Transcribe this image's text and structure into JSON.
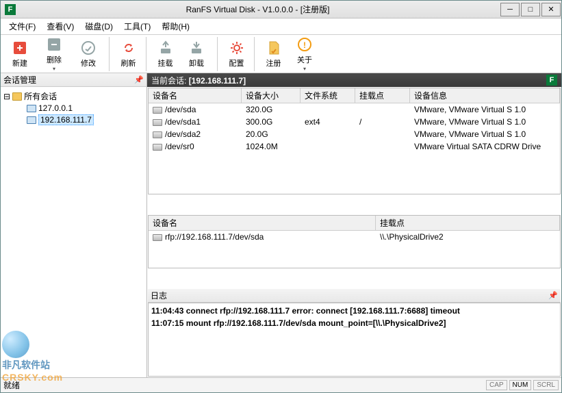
{
  "window": {
    "title": "RanFS Virtual Disk - V1.0.0.0 - [注册版]",
    "icon_letter": "F"
  },
  "menu": {
    "file": "文件(F)",
    "view": "查看(V)",
    "disk": "磁盘(D)",
    "tool": "工具(T)",
    "help": "帮助(H)"
  },
  "toolbar": {
    "new": "新建",
    "delete": "删除",
    "modify": "修改",
    "refresh": "刷新",
    "mount": "挂载",
    "unmount": "卸载",
    "config": "配置",
    "register": "注册",
    "about": "关于"
  },
  "sidebar": {
    "title": "会话管理",
    "root": "所有会话",
    "nodes": [
      "127.0.0.1",
      "192.168.111.7"
    ],
    "selected": "192.168.111.7"
  },
  "session_bar": {
    "label": "当前会话:",
    "value": "[192.168.111.7]"
  },
  "devices": {
    "headers": {
      "name": "设备名",
      "size": "设备大小",
      "fs": "文件系统",
      "mount": "挂载点",
      "info": "设备信息"
    },
    "rows": [
      {
        "name": "/dev/sda",
        "size": "320.0G",
        "fs": "",
        "mount": "",
        "info": "VMware, VMware Virtual S 1.0"
      },
      {
        "name": "/dev/sda1",
        "size": "300.0G",
        "fs": "ext4",
        "mount": "/",
        "info": "VMware, VMware Virtual S 1.0"
      },
      {
        "name": "/dev/sda2",
        "size": "20.0G",
        "fs": "",
        "mount": "",
        "info": "VMware, VMware Virtual S 1.0"
      },
      {
        "name": "/dev/sr0",
        "size": "1024.0M",
        "fs": "",
        "mount": "",
        "info": "VMware Virtual SATA CDRW Drive"
      }
    ]
  },
  "mounts": {
    "headers": {
      "name": "设备名",
      "mount": "挂载点"
    },
    "rows": [
      {
        "name": "rfp://192.168.111.7/dev/sda",
        "mount": "\\\\.\\PhysicalDrive2"
      }
    ]
  },
  "log": {
    "title": "日志",
    "lines": [
      "11:04:43 connect rfp://192.168.111.7 error: connect [192.168.111.7:6688] timeout",
      "11:07:15 mount rfp://192.168.111.7/dev/sda mount_point=[\\\\.\\PhysicalDrive2]"
    ]
  },
  "status": {
    "ready": "就绪",
    "cap": "CAP",
    "num": "NUM",
    "scrl": "SCRL"
  },
  "watermark": {
    "line1": "非凡软件站",
    "line2": "CRSKY.com"
  },
  "colors": {
    "accent_green": "#0a7a3a",
    "toolbar_red": "#e74c3c",
    "toolbar_orange": "#f39c12",
    "toolbar_gray": "#95a5a6"
  }
}
